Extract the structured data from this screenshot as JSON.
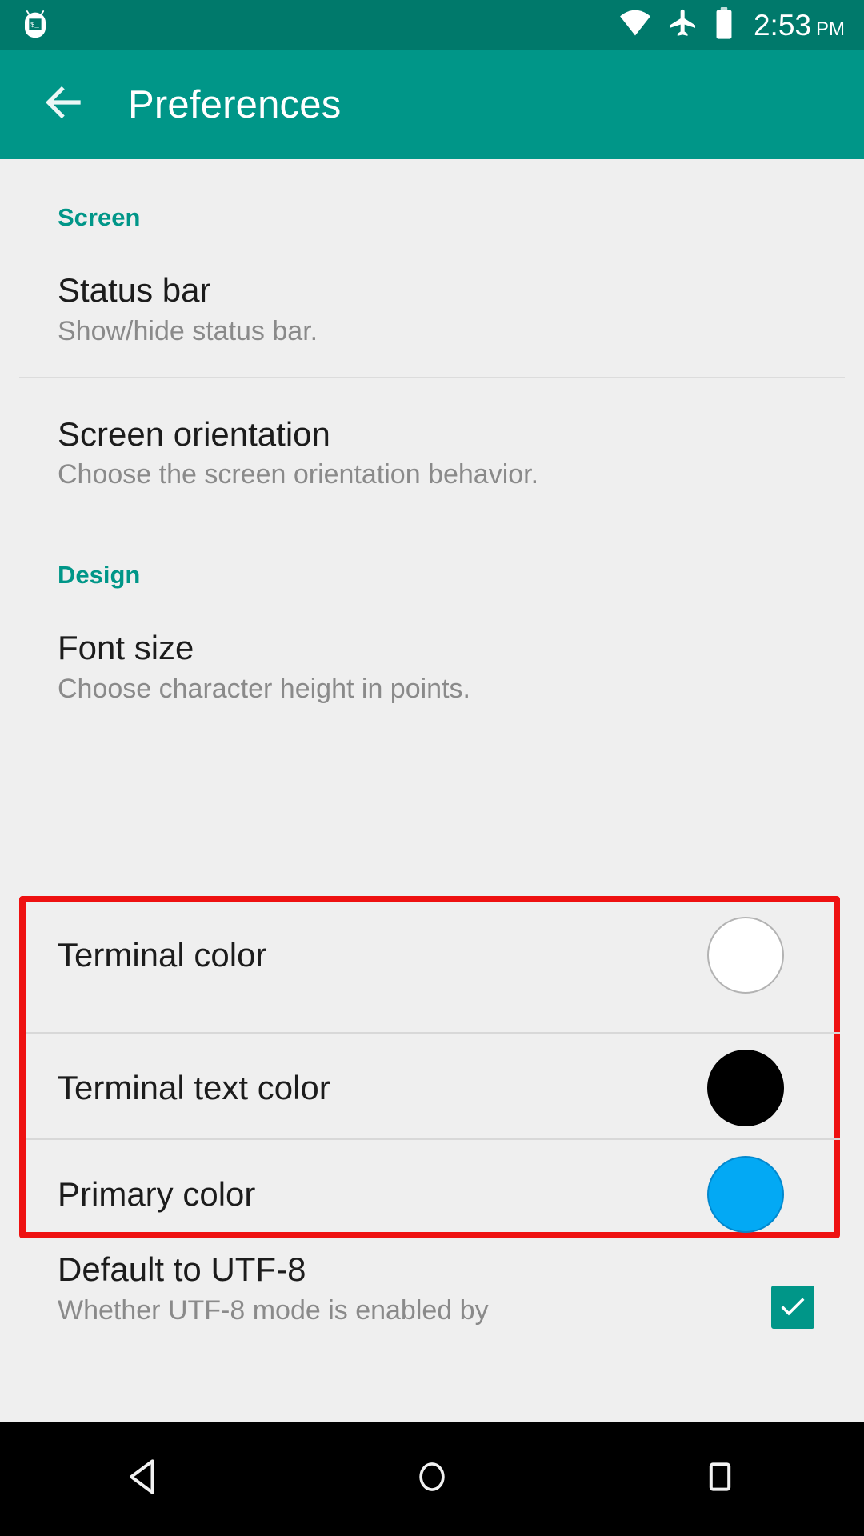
{
  "status_bar": {
    "notification_icon": "android-terminal-icon",
    "wifi_icon": "wifi-icon",
    "airplane_icon": "airplane-mode-icon",
    "battery_icon": "battery-full-icon",
    "time": "2:53",
    "ampm": "PM",
    "background_color": "#00796b"
  },
  "app_bar": {
    "back_icon": "back-arrow-icon",
    "title": "Preferences",
    "background_color": "#009688"
  },
  "sections": [
    {
      "header": "Screen",
      "items": [
        {
          "title": "Status bar",
          "summary": "Show/hide status bar."
        },
        {
          "title": "Screen orientation",
          "summary": "Choose the screen orientation behavior."
        }
      ]
    },
    {
      "header": "Design",
      "items": [
        {
          "title": "Font size",
          "summary": "Choose character height in points."
        }
      ]
    }
  ],
  "highlighted_group": {
    "border_color": "#ee1111",
    "rows": [
      {
        "label": "Terminal color",
        "swatch_color": "#ffffff",
        "swatch_border": "#b3b3b3"
      },
      {
        "label": "Terminal text color",
        "swatch_color": "#000000",
        "swatch_border": "#000000"
      },
      {
        "label": "Primary color",
        "swatch_color": "#03a9f4",
        "swatch_border": "#0288ce"
      }
    ]
  },
  "utf8_item": {
    "title": "Default to UTF-8",
    "summary": "Whether UTF-8 mode is enabled by",
    "checked": true,
    "checkbox_color": "#009688"
  },
  "nav_bar": {
    "back": "nav-back-icon",
    "home": "nav-home-icon",
    "recents": "nav-recents-icon",
    "background_color": "#000000"
  }
}
